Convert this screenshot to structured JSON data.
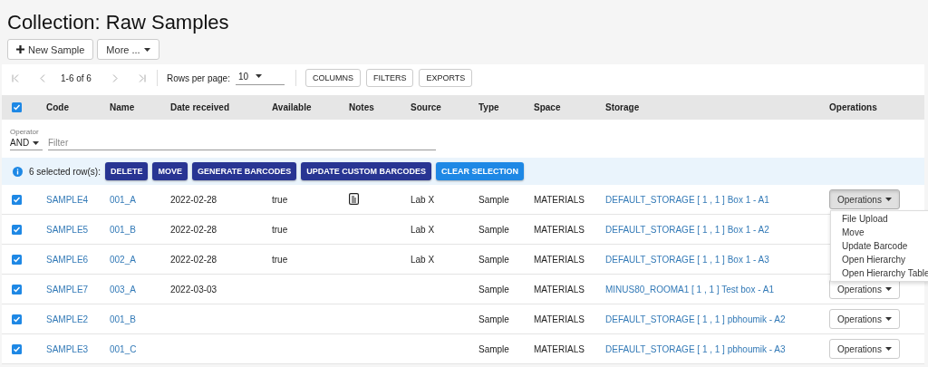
{
  "title": "Collection: Raw Samples",
  "actions": [
    {
      "kind": "add",
      "label": "New Sample"
    },
    {
      "kind": "dropdown",
      "label": "More ..."
    }
  ],
  "pager": {
    "range": "1-6 of 6",
    "rows_per_page_label": "Rows per page:",
    "rows_per_page": "10"
  },
  "toolbar_buttons": [
    "COLUMNS",
    "FILTERS",
    "EXPORTS"
  ],
  "select_all": {
    "checked": true
  },
  "columns": [
    "Code",
    "Name",
    "Date received",
    "Available",
    "Notes",
    "Source",
    "Type",
    "Space",
    "Storage",
    "Operations"
  ],
  "filter": {
    "operator_label": "Operator",
    "operator": "AND",
    "placeholder": "Filter"
  },
  "selection_bar": {
    "message": "6 selected row(s):",
    "buttons": [
      {
        "label": "DELETE",
        "kind": "primary"
      },
      {
        "label": "MOVE",
        "kind": "primary"
      },
      {
        "label": "GENERATE BARCODES",
        "kind": "primary"
      },
      {
        "label": "UPDATE CUSTOM BARCODES",
        "kind": "primary"
      },
      {
        "label": "CLEAR SELECTION",
        "kind": "secondary"
      }
    ]
  },
  "rows": [
    {
      "checked": true,
      "code": "SAMPLE4",
      "name": "001_A",
      "date": "2022-02-28",
      "available": "true",
      "has_note": true,
      "source": "Lab X",
      "type": "Sample",
      "space": "MATERIALS",
      "storage": "DEFAULT_STORAGE [ 1 , 1 ] Box 1 - A1",
      "operations": {
        "label": "Operations",
        "open": true
      }
    },
    {
      "checked": true,
      "code": "SAMPLE5",
      "name": "001_B",
      "date": "2022-02-28",
      "available": "true",
      "has_note": false,
      "source": "Lab X",
      "type": "Sample",
      "space": "MATERIALS",
      "storage": "DEFAULT_STORAGE [ 1 , 1 ] Box 1 - A2"
    },
    {
      "checked": true,
      "code": "SAMPLE6",
      "name": "002_A",
      "date": "2022-02-28",
      "available": "true",
      "has_note": false,
      "source": "Lab X",
      "type": "Sample",
      "space": "MATERIALS",
      "storage": "DEFAULT_STORAGE [ 1 , 1 ] Box 1 - A3"
    },
    {
      "checked": true,
      "code": "SAMPLE7",
      "name": "003_A",
      "date": "2022-03-03",
      "has_note": false,
      "type": "Sample",
      "space": "MATERIALS",
      "storage": "MINUS80_ROOMA1 [ 1 , 1 ] Test box - A1",
      "operations": {
        "label": "Operations",
        "open": false
      }
    },
    {
      "checked": true,
      "code": "SAMPLE2",
      "name": "001_B",
      "has_note": false,
      "type": "Sample",
      "space": "MATERIALS",
      "storage": "DEFAULT_STORAGE [ 1 , 1 ] pbhoumik - A2",
      "operations": {
        "label": "Operations",
        "open": false
      }
    },
    {
      "checked": true,
      "code": "SAMPLE3",
      "name": "001_C",
      "has_note": false,
      "type": "Sample",
      "space": "MATERIALS",
      "storage": "DEFAULT_STORAGE [ 1 , 1 ] pbhoumik - A3",
      "operations": {
        "label": "Operations",
        "open": false
      }
    }
  ],
  "operations_menu": [
    "File Upload",
    "Move",
    "Update Barcode",
    "Open Hierarchy",
    "Open Hierarchy Table"
  ]
}
